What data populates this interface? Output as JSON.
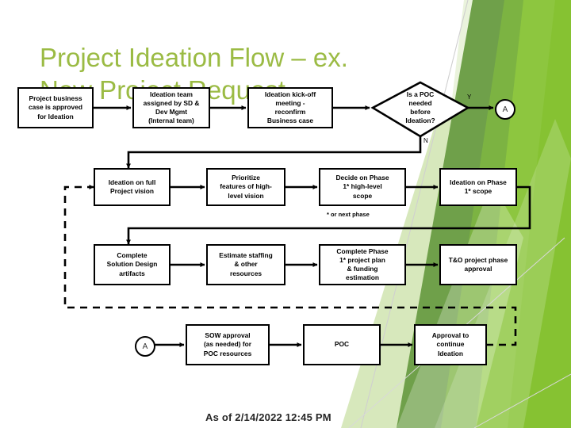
{
  "title": "Project Ideation Flow – ex.\nNew Project Request",
  "colors": {
    "title_green": "#9BBB44",
    "bg_dark_green": "#6FA04A",
    "bg_mid_green": "#7DB63A",
    "bg_bright_green": "#8DC63F",
    "bg_pale_green": "#D7E8BC",
    "line_black": "#000000"
  },
  "row1": {
    "nodes": [
      {
        "id": "project-business-case",
        "text": "Project business\ncase is approved\nfor Ideation"
      },
      {
        "id": "ideation-team-assigned",
        "text": "Ideation team\nassigned by SD &\nDev Mgmt\n(Internal team)"
      },
      {
        "id": "ideation-kickoff",
        "text": "Ideation kick-off\nmeeting -\nreconfirm\nBusiness case"
      }
    ],
    "decision": {
      "id": "poc-needed-decision",
      "text": "Is a POC\nneeded\nbefore\nIdeation?"
    },
    "branch_yes": "Y",
    "branch_no": "N",
    "connector": "A"
  },
  "row2": {
    "nodes": [
      {
        "id": "ideation-full-project-vision",
        "text": "Ideation on full\nProject vision"
      },
      {
        "id": "prioritize-features",
        "text": "Prioritize\nfeatures of high-\nlevel vision"
      },
      {
        "id": "decide-phase-scope",
        "text": "Decide on Phase\n1* high-level\nscope"
      },
      {
        "id": "ideation-phase-scope",
        "text": "Ideation on Phase\n1* scope"
      }
    ],
    "footnote": "* or next phase"
  },
  "row3": {
    "nodes": [
      {
        "id": "complete-solution-design",
        "text": "Complete\nSolution Design\nartifacts"
      },
      {
        "id": "estimate-staffing",
        "text": "Estimate staffing\n& other\nresources"
      },
      {
        "id": "complete-project-plan",
        "text": "Complete Phase\n1* project plan\n& funding\nestimation"
      },
      {
        "id": "to-project-phase-approval",
        "text": "T&O project phase\napproval"
      }
    ]
  },
  "row4": {
    "connector": "A",
    "nodes": [
      {
        "id": "sow-approval",
        "text": "SOW approval\n(as needed) for\nPOC resources"
      },
      {
        "id": "poc",
        "text": "POC"
      },
      {
        "id": "approval-continue-ideation",
        "text": "Approval to\ncontinue\nIdeation"
      }
    ]
  },
  "footer": {
    "stamp": "As of 2/14/2022 12:45 PM"
  }
}
